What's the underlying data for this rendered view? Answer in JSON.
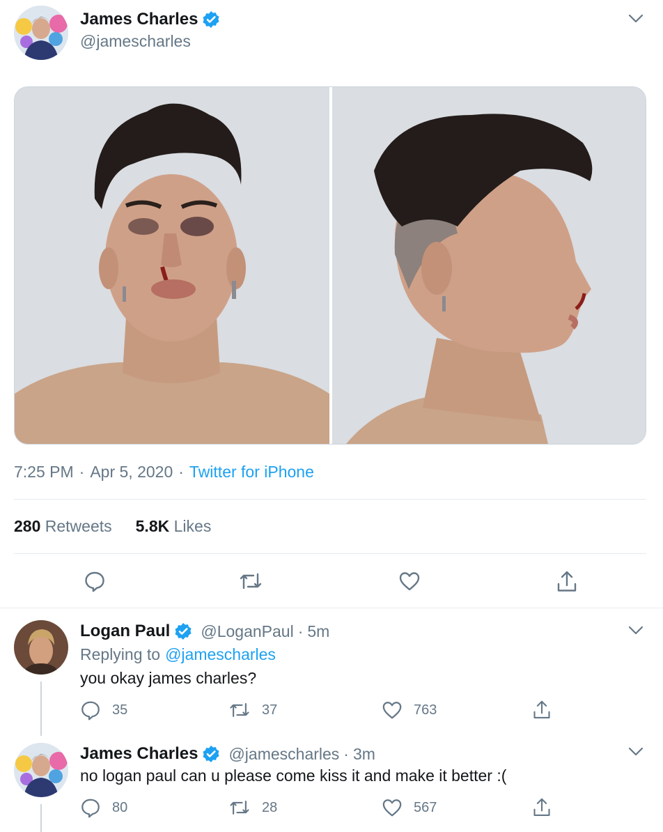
{
  "tweet": {
    "author_name": "James Charles",
    "author_handle": "@jamescharles",
    "time": "7:25 PM",
    "date": "Apr 5, 2020",
    "source": "Twitter for iPhone",
    "retweets_count": "280",
    "retweets_label": "Retweets",
    "likes_count": "5.8K",
    "likes_label": "Likes",
    "separator": "·",
    "verified": true
  },
  "replies": [
    {
      "author_name": "Logan Paul",
      "author_handle": "@LoganPaul",
      "time": "5m",
      "replying_prefix": "Replying to",
      "replying_to": "@jamescharles",
      "text": "you okay james charles?",
      "reply_count": "35",
      "retweet_count": "37",
      "like_count": "763"
    },
    {
      "author_name": "James Charles",
      "author_handle": "@jamescharles",
      "time": "3m",
      "text": "no logan paul can u please come kiss it and make it better :(",
      "reply_count": "80",
      "retweet_count": "28",
      "like_count": "567"
    }
  ],
  "colors": {
    "accent": "#1da1f2",
    "secondary_text": "#657786",
    "divider": "#e6ecf0"
  },
  "icons": [
    "chevron-down-icon",
    "verified-badge-icon",
    "reply-icon",
    "retweet-icon",
    "heart-icon",
    "share-icon"
  ]
}
